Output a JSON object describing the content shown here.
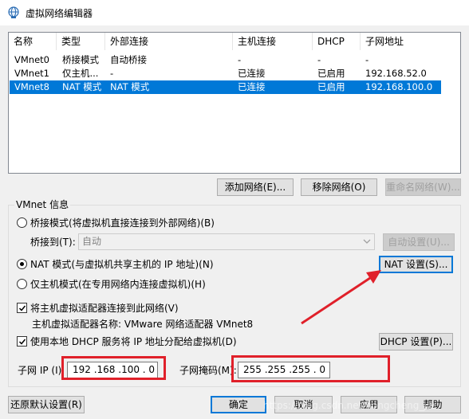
{
  "window": {
    "title": "虚拟网络编辑器",
    "icon": "network-globe-icon"
  },
  "table": {
    "columns": [
      "名称",
      "类型",
      "外部连接",
      "主机连接",
      "DHCP",
      "子网地址"
    ],
    "rows": [
      [
        "VMnet0",
        "桥接模式",
        "自动桥接",
        "-",
        "-",
        "-"
      ],
      [
        "VMnet1",
        "仅主机...",
        "-",
        "已连接",
        "已启用",
        "192.168.52.0"
      ],
      [
        "VMnet8",
        "NAT 模式",
        "NAT 模式",
        "已连接",
        "已启用",
        "192.168.100.0"
      ]
    ],
    "selected_row": 2
  },
  "table_buttons": {
    "add": "添加网络(E)...",
    "remove": "移除网络(O)",
    "rename": "重命名网络(W)..."
  },
  "vmnet_info": {
    "title": "VMnet 信息",
    "bridge_radio": "桥接模式(将虚拟机直接连接到外部网络)(B)",
    "bridge_to_label": "桥接到(T):",
    "bridge_to_value": "自动",
    "auto_settings": "自动设置(U)...",
    "nat_radio": "NAT 模式(与虚拟机共享主机的 IP 地址)(N)",
    "nat_settings": "NAT 设置(S)...",
    "host_only_radio": "仅主机模式(在专用网络内连接虚拟机)(H)",
    "connect_adapter": "将主机虚拟适配器连接到此网络(V)",
    "adapter_name": "主机虚拟适配器名称: VMware 网络适配器 VMnet8",
    "use_dhcp": "使用本地 DHCP 服务将 IP 地址分配给虚拟机(D)",
    "dhcp_settings": "DHCP 设置(P)...",
    "subnet_ip_label": "子网 IP (I):",
    "subnet_ip_value": "192 .168 .100 . 0",
    "subnet_mask_label": "子网掩码(M):",
    "subnet_mask_value": "255 .255 .255 . 0",
    "selected_mode": "nat",
    "connect_adapter_checked": true,
    "use_dhcp_checked": true
  },
  "footer": {
    "restore": "还原默认设置(R)",
    "ok": "确定",
    "cancel": "取消",
    "apply": "应用",
    "help": "帮助"
  },
  "watermark": "https://blog.csdn.net/hongcheng_jie",
  "colors": {
    "selection": "#0078d7",
    "highlight_red": "#e0202a"
  }
}
